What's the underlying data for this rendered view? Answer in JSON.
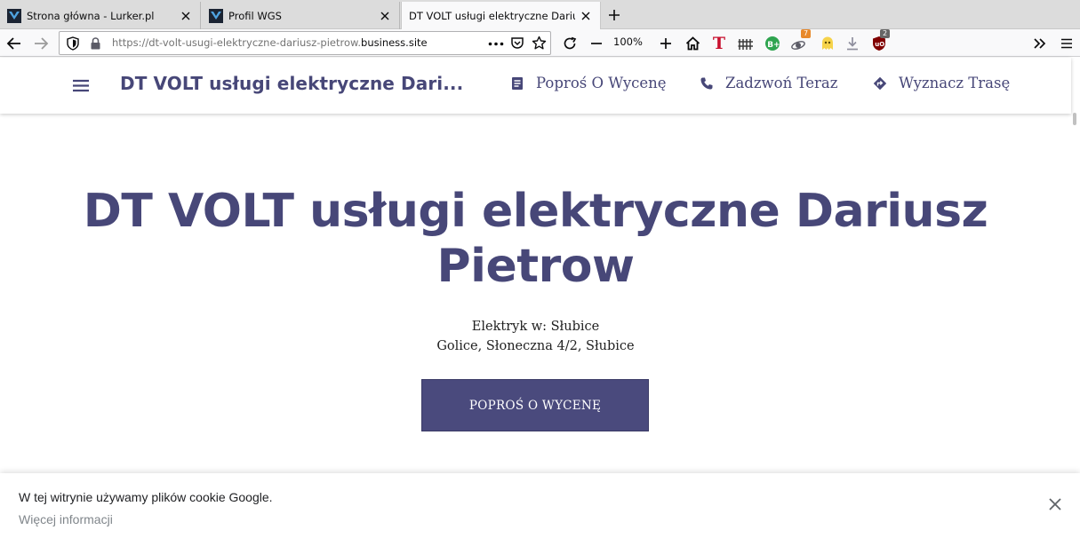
{
  "browser": {
    "tabs": [
      {
        "title": "Strona główna - Lurker.pl",
        "icon": "lurker-favicon"
      },
      {
        "title": "Profil WGS",
        "icon": "lurker-favicon"
      },
      {
        "title": "DT VOLT usługi elektryczne Dariusz P",
        "icon": "none"
      }
    ],
    "url": {
      "prefix": "https://dt-volt-usugi-elektryczne-dariusz-pietrow.",
      "domain": "business.site"
    },
    "zoom": "100%",
    "badges": {
      "extension_orange": "7",
      "ublock": "2"
    }
  },
  "site": {
    "header_title": "DT VOLT usługi elektryczne Dari...",
    "nav": {
      "quote": "Poproś O Wycenę",
      "call": "Zadzwoń Teraz",
      "route": "Wyznacz Trasę"
    },
    "hero": {
      "title_line1": "DT VOLT usługi elektryczne Dariusz",
      "title_line2": "Pietrow",
      "category": "Elektryk w: Słubice",
      "address": "Golice, Słoneczna 4/2, Słubice",
      "cta": "POPROŚ O WYCENĘ"
    },
    "cookie": {
      "text": "W tej witrynie używamy plików cookie Google.",
      "link": "Więcej informacji"
    }
  },
  "colors": {
    "brand": "#474778",
    "cta_bg": "#4a4a7d",
    "tabstrip": "#dcdcdc",
    "toolbar": "#f9f9fa"
  }
}
